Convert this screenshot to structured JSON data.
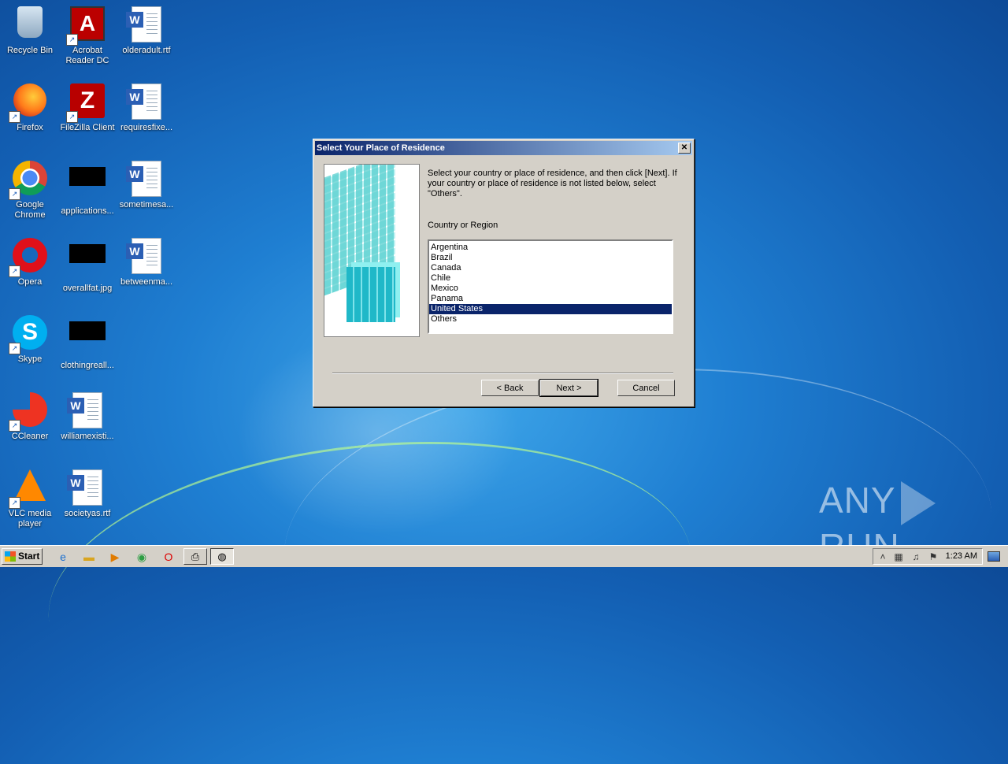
{
  "desktop": {
    "icons": [
      {
        "label": "Recycle Bin"
      },
      {
        "label": "Acrobat Reader DC"
      },
      {
        "label": "olderadult.rtf"
      },
      {
        "label": "Firefox"
      },
      {
        "label": "FileZilla Client"
      },
      {
        "label": "requiresfixe..."
      },
      {
        "label": "Google Chrome"
      },
      {
        "label": "applications..."
      },
      {
        "label": "sometimesa..."
      },
      {
        "label": "Opera"
      },
      {
        "label": "overallfat.jpg"
      },
      {
        "label": "betweenma..."
      },
      {
        "label": "Skype"
      },
      {
        "label": "clothingreall..."
      },
      {
        "label": "CCleaner"
      },
      {
        "label": "williamexisti..."
      },
      {
        "label": "VLC media player"
      },
      {
        "label": "societyas.rtf"
      }
    ]
  },
  "dialog": {
    "title": "Select Your Place of Residence",
    "close_glyph": "✕",
    "instructions": "Select your country or place of residence, and then click [Next]. If your country or place of residence is not listed below, select \"Others\".",
    "list_label": "Country or Region",
    "countries": [
      "Argentina",
      "Brazil",
      "Canada",
      "Chile",
      "Mexico",
      "Panama",
      "United States",
      "Others"
    ],
    "selected": "United States",
    "buttons": {
      "back": "< Back",
      "next": "Next >",
      "cancel": "Cancel"
    }
  },
  "watermark": {
    "left": "ANY",
    "right": "RUN"
  },
  "taskbar": {
    "start_label": "Start",
    "clock": "1:23 AM"
  }
}
